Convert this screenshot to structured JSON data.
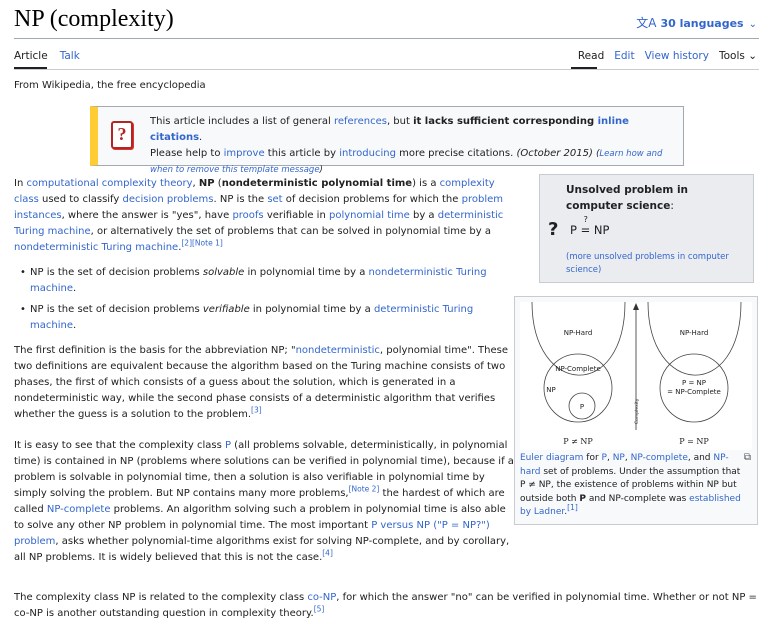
{
  "page": {
    "title": "NP (complexity)",
    "languages": "30 languages",
    "tagline": "From Wikipedia, the free encyclopedia"
  },
  "tabs": {
    "article": "Article",
    "talk": "Talk",
    "read": "Read",
    "edit": "Edit",
    "history": "View history",
    "tools": "Tools"
  },
  "ambox": {
    "t1": "This article includes a list of general ",
    "l1": "references",
    "t2": ", but ",
    "b1": "it lacks sufficient corresponding ",
    "l2": "inline citations",
    "t3": ".",
    "t4": "Please help to ",
    "l3": "improve",
    "t5": " this article by ",
    "l4": "introducing",
    "t6": " more precise citations. ",
    "date": "(October 2015)",
    "help1": "(",
    "help2": "Learn how and when to remove this template message",
    "help3": ")"
  },
  "intro": {
    "a": "In ",
    "l1": "computational complexity theory",
    "b": ", ",
    "np": "NP",
    "c": " (",
    "full": "nondeterministic polynomial time",
    "d": ") is a ",
    "l2": "complexity class",
    "e": " used to classify ",
    "l3": "decision problems",
    "f": ". NP is the ",
    "l4": "set",
    "g": " of decision problems for which the ",
    "l5": "problem instances",
    "h": ", where the answer is \"yes\", have ",
    "l6": "proofs",
    "i": " verifiable in ",
    "l7": "polynomial time",
    "j": " by a ",
    "l8": "deterministic Turing machine",
    "k": ", or alternatively the set of problems that can be solved in polynomial time by a ",
    "l9": "nondeterministic Turing machine",
    "m": ".",
    "s1": "[2]",
    "s2": "[Note 1]"
  },
  "bullets": {
    "b1a": "NP is the set of decision problems ",
    "b1i": "solvable",
    "b1b": " in polynomial time by a ",
    "b1l": "nondeterministic Turing machine",
    "b1c": ".",
    "b2a": "NP is the set of decision problems ",
    "b2i": "verifiable",
    "b2b": " in polynomial time by a ",
    "b2l": "deterministic Turing machine",
    "b2c": "."
  },
  "p2": {
    "a": "The first definition is the basis for the abbreviation NP; \"",
    "l1": "nondeterministic",
    "b": ", polynomial time\". These two definitions are equivalent because the algorithm based on the Turing machine consists of two phases, the first of which consists of a guess about the solution, which is generated in a nondeterministic way, while the second phase consists of a deterministic algorithm that verifies whether the guess is a solution to the problem.",
    "s1": "[3]"
  },
  "p3": {
    "a": "It is easy to see that the complexity class ",
    "l1": "P",
    "b": " (all problems solvable, deterministically, in polynomial time) is contained in NP (problems where solutions can be verified in polynomial time), because if a problem is solvable in polynomial time, then a solution is also verifiable in polynomial time by simply solving the problem. But NP contains many more problems,",
    "s1": "[Note 2]",
    "c": " the hardest of which are called ",
    "l2": "NP-complete",
    "d": " problems. An algorithm solving such a problem in polynomial time is also able to solve any other NP problem in polynomial time. The most important ",
    "l3": "P versus NP (\"P = NP?\") problem",
    "e": ", asks whether polynomial-time algorithms exist for solving NP-complete, and by corollary, all NP problems. It is widely believed that this is not the case.",
    "s2": "[4]"
  },
  "p4": {
    "a": "The complexity class NP is related to the complexity class ",
    "l1": "co-NP",
    "b": ", for which the answer \"no\" can be verified in polynomial time. Whether or not NP = co-NP is another outstanding question in complexity theory.",
    "s1": "[5]"
  },
  "unsolved": {
    "heading": "Unsolved problem in computer science",
    "colon": ":",
    "q": "?",
    "lhs": "P",
    "qm": "?",
    "rhs": "NP",
    "more": "(more unsolved problems in computer science)"
  },
  "figure": {
    "left_np_hard": "NP-Hard",
    "left_np_complete": "NP-Complete",
    "left_np": "NP",
    "left_p": "P",
    "left_caption": "P ≠ NP",
    "right_np_hard": "NP-Hard",
    "right_p_np": "P = NP",
    "right_p_np_c": "= NP-Complete",
    "right_caption": "P = NP",
    "axis": "Complexity",
    "enlarge": "⧉",
    "cap": {
      "a": "Euler diagram",
      "b": " for ",
      "l1": "P",
      "c": ", ",
      "l2": "NP",
      "d": ", ",
      "l3": "NP-complete",
      "e": ", and ",
      "l4": "NP-hard",
      "f": " set of problems. Under the assumption that P ≠ NP, the existence of problems within NP but outside both ",
      "b1": "P",
      "g": " and NP-complete was ",
      "l5": "established by Ladner",
      "h": ".",
      "s1": "[1]"
    }
  }
}
